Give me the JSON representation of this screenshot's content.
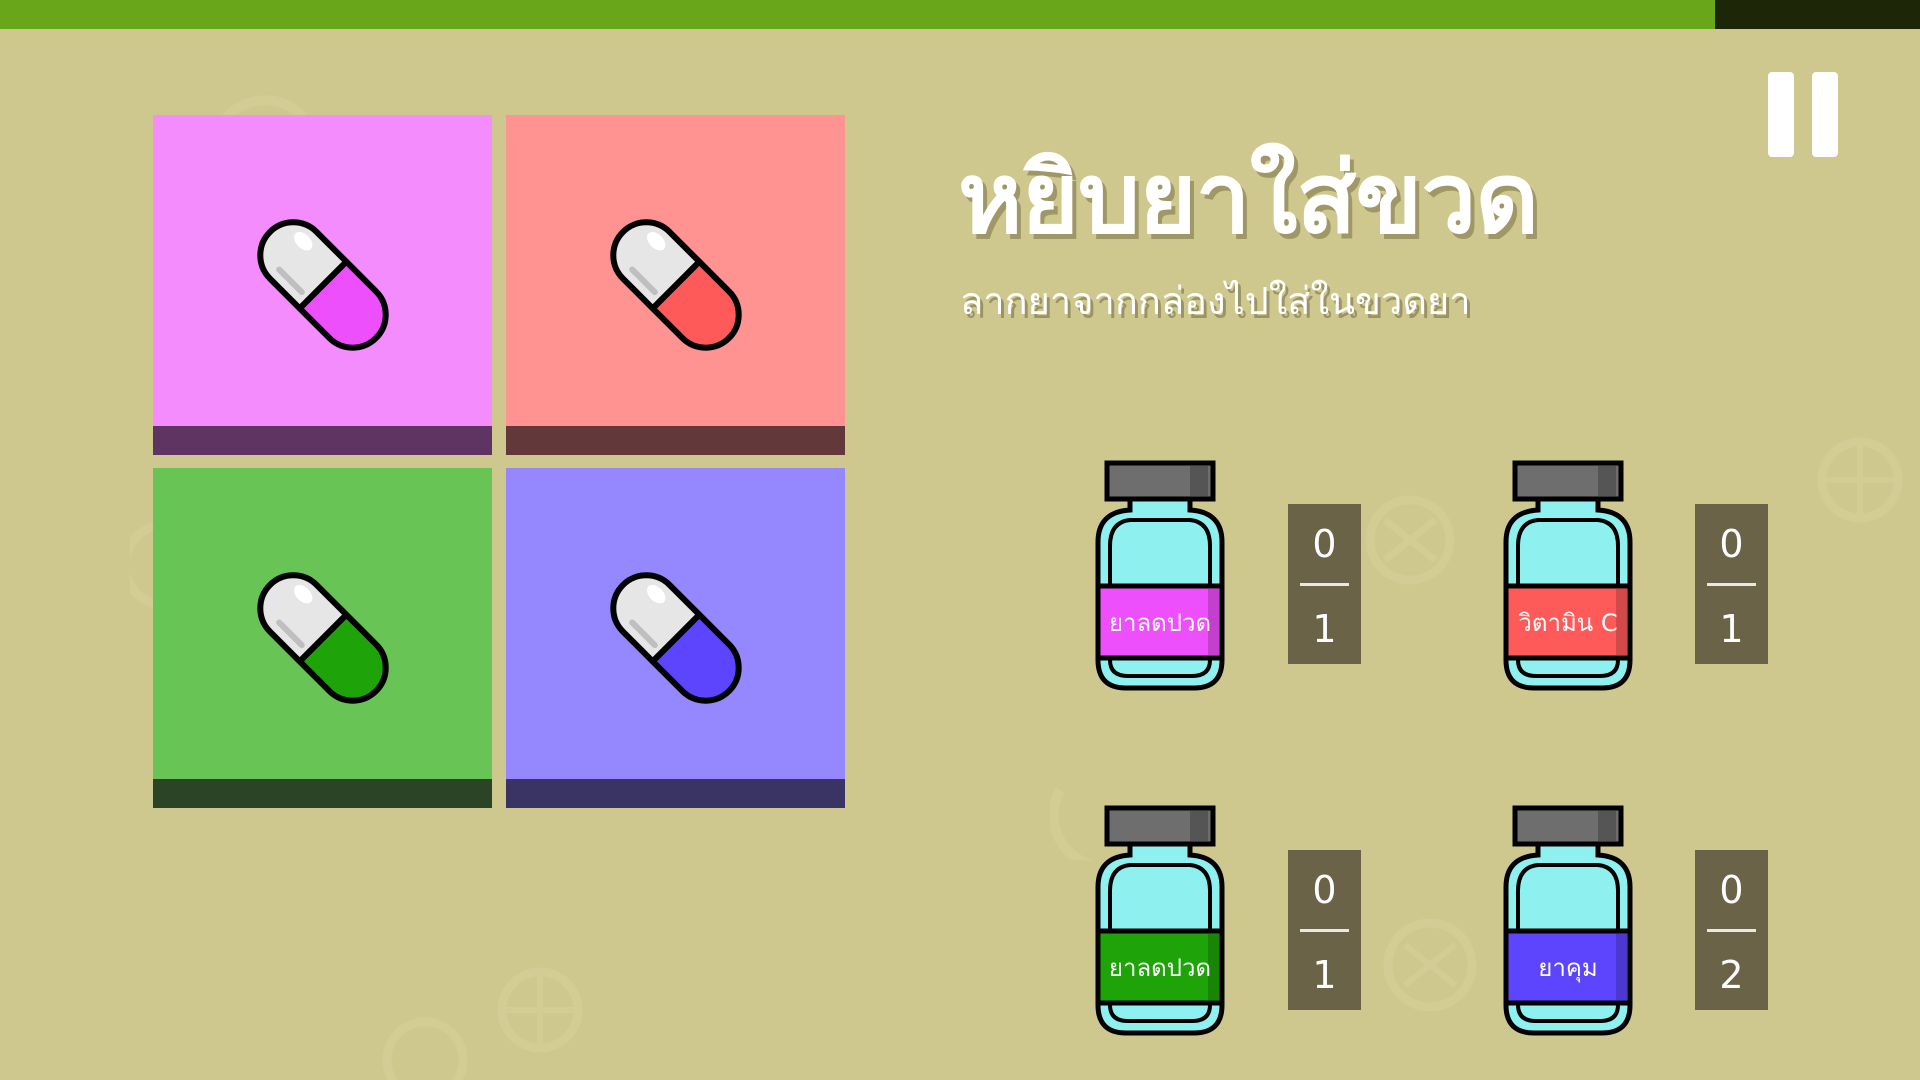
{
  "game": {
    "title": "หยิบยาใส่ขวด",
    "instruction": "ลากยาจากกล่องไปใส่ในขวดยา",
    "progress": 0.893
  },
  "colors": {
    "background": "#cec78e",
    "progress_fill": "#6aa619",
    "progress_track": "#1e2608",
    "counter_bg": "#6a6348"
  },
  "tiles": [
    {
      "name": "pill-tile-pink",
      "bg": "#f48cfd",
      "strip": "#5e3462",
      "pill": "#ee4ffc"
    },
    {
      "name": "pill-tile-red",
      "bg": "#fe9391",
      "strip": "#62383a",
      "pill": "#ff5a5a"
    },
    {
      "name": "pill-tile-green",
      "bg": "#68c454",
      "strip": "#2b4426",
      "pill": "#1ea309"
    },
    {
      "name": "pill-tile-purple",
      "bg": "#9587fd",
      "strip": "#3a3465",
      "pill": "#5d44fd"
    }
  ],
  "bottles": [
    {
      "label": "ยาลดปวด",
      "label_color": "#ee4ffc",
      "count": "0",
      "target": "1"
    },
    {
      "label": "วิตามิน C",
      "label_color": "#ff5a5a",
      "count": "0",
      "target": "1"
    },
    {
      "label": "ยาลดปวด",
      "label_color": "#1ea309",
      "count": "0",
      "target": "1"
    },
    {
      "label": "ยาคุม",
      "label_color": "#5d44fd",
      "count": "0",
      "target": "2"
    }
  ],
  "icons": {
    "pause": "pause-icon",
    "pill": "capsule-pill-icon",
    "bottle": "medicine-bottle-icon",
    "background": "pizza-slice-icon"
  }
}
